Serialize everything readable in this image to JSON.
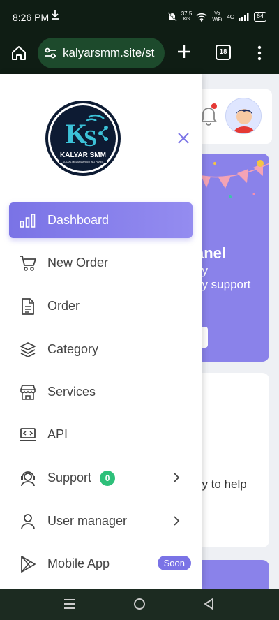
{
  "status_bar": {
    "time": "8:26 PM",
    "download_icon": "download-arrow-icon",
    "speed_value": "37.5",
    "speed_unit": "K/S",
    "wifi_label": "Vo WiFi",
    "network": "4G",
    "battery": "64"
  },
  "browser": {
    "url": "kalyarsmm.site/st",
    "tab_count": "18"
  },
  "drawer": {
    "logo_text": "KALYAR SMM",
    "logo_tagline": "SOCIAL MEDIA MARKETING PANEL",
    "items": [
      {
        "label": "Dashboard",
        "icon": "bar-chart-icon",
        "active": true
      },
      {
        "label": "New Order",
        "icon": "cart-icon"
      },
      {
        "label": "Order",
        "icon": "document-icon"
      },
      {
        "label": "Category",
        "icon": "layers-icon"
      },
      {
        "label": "Services",
        "icon": "store-icon"
      },
      {
        "label": "API",
        "icon": "laptop-code-icon"
      },
      {
        "label": "Support",
        "icon": "support-agent-icon",
        "badge": "0",
        "has_submenu": true
      },
      {
        "label": "User manager",
        "icon": "user-icon",
        "has_submenu": true
      },
      {
        "label": "Mobile App",
        "icon": "play-store-icon",
        "tag": "Soon"
      }
    ]
  },
  "page_behind": {
    "banner_title": "anel",
    "banner_line1": "ay",
    "banner_line2": "ny support",
    "info_text": "py to help"
  },
  "colors": {
    "accent": "#7a73e6",
    "badge_green": "#2ec07a",
    "status_bar": "#0f1d14",
    "url_pill": "#1d4a2c"
  }
}
